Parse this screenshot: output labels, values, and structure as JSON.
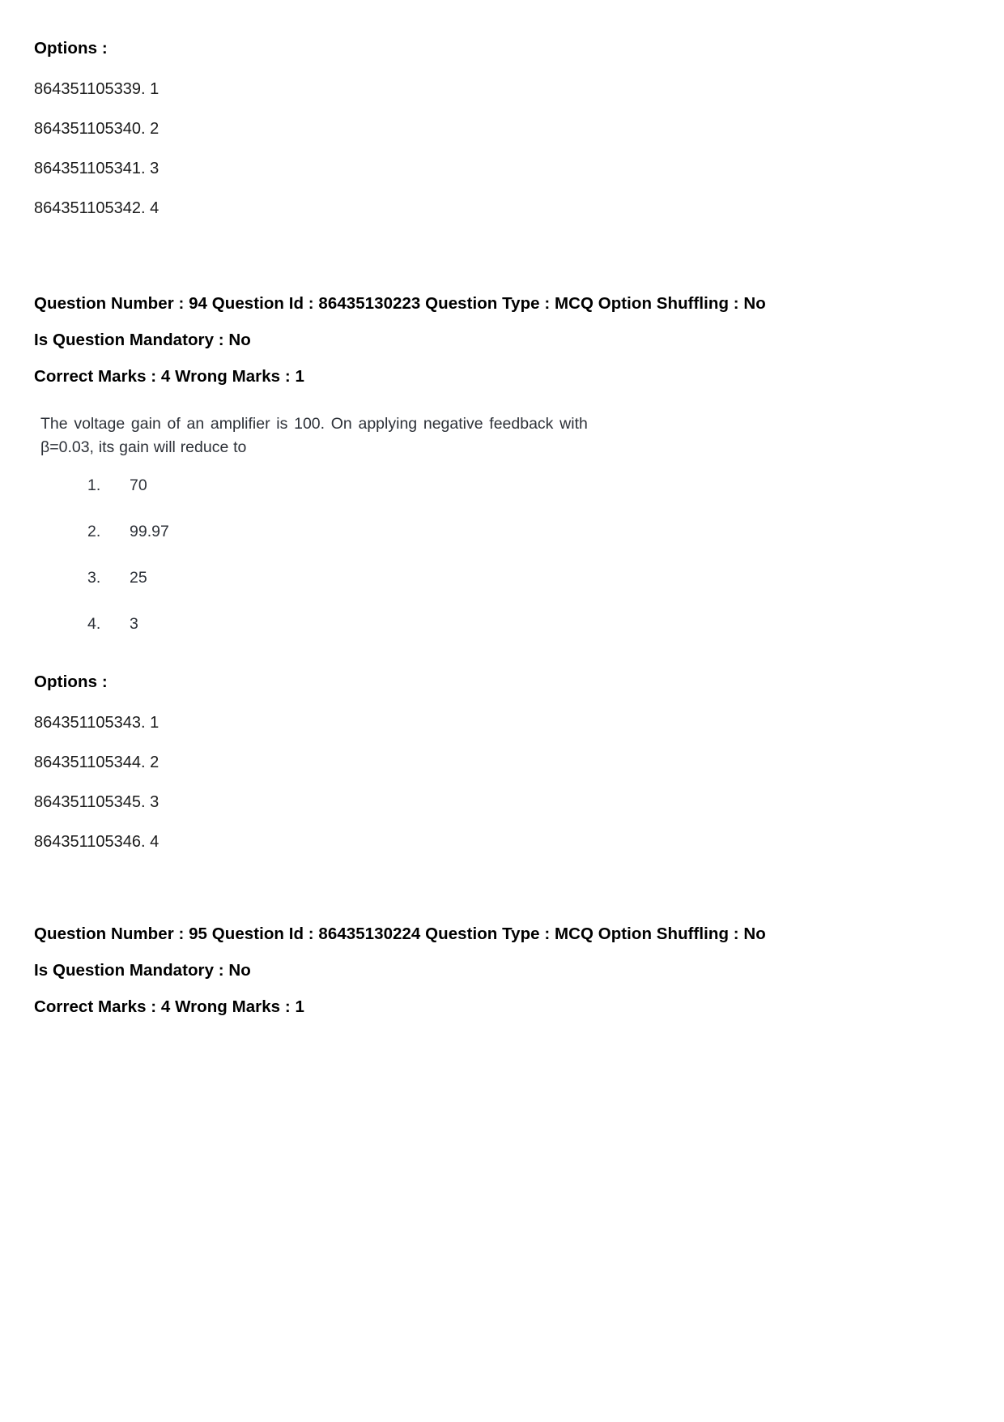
{
  "document": {
    "options_label": "Options :"
  },
  "blocks": {
    "first_options": {
      "label": "Options :",
      "items": [
        "864351105339. 1",
        "864351105340. 2",
        "864351105341. 3",
        "864351105342. 4"
      ]
    },
    "question_94": {
      "meta_line_1": "Question Number : 94 Question Id : 86435130223 Question Type : MCQ Option Shuffling : No",
      "meta_line_2": "Is Question Mandatory : No",
      "meta_line_3": "Correct Marks : 4 Wrong Marks : 1",
      "question_number": "94",
      "question_id": "86435130223",
      "question_type": "MCQ",
      "option_shuffling": "No",
      "is_question_mandatory": "No",
      "correct_marks": "4",
      "wrong_marks": "1",
      "stem_line_1": "The voltage gain of an amplifier is 100. On applying negative feedback with",
      "stem_line_2": "β=0.03, its gain will reduce to",
      "choices": [
        {
          "num": "1.",
          "value": "70"
        },
        {
          "num": "2.",
          "value": "99.97"
        },
        {
          "num": "3.",
          "value": "25"
        },
        {
          "num": "4.",
          "value": "3"
        }
      ],
      "options_label": "Options :",
      "option_ids": [
        "864351105343. 1",
        "864351105344. 2",
        "864351105345. 3",
        "864351105346. 4"
      ]
    },
    "question_95": {
      "meta_line_1": "Question Number : 95 Question Id : 86435130224 Question Type : MCQ Option Shuffling : No",
      "meta_line_2": "Is Question Mandatory : No",
      "meta_line_3": "Correct Marks : 4 Wrong Marks : 1",
      "question_number": "95",
      "question_id": "86435130224",
      "question_type": "MCQ",
      "option_shuffling": "No",
      "is_question_mandatory": "No",
      "correct_marks": "4",
      "wrong_marks": "1"
    }
  }
}
